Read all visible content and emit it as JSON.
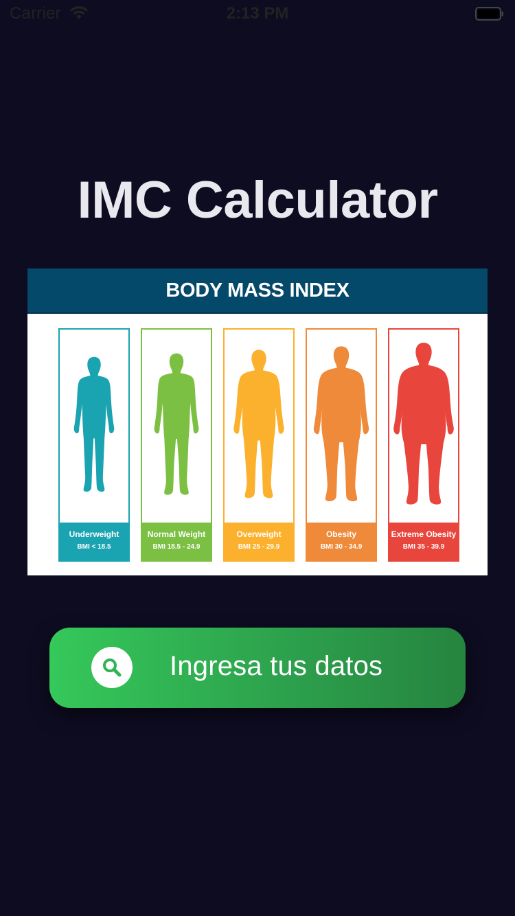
{
  "status_bar": {
    "carrier": "Carrier",
    "time": "2:13 PM"
  },
  "title": "IMC Calculator",
  "bmi_chart": {
    "header": "BODY MASS INDEX",
    "categories": [
      {
        "name": "Underweight",
        "range": "BMI < 18.5",
        "color": "#1aa3b0"
      },
      {
        "name": "Normal Weight",
        "range": "BMI 18.5 - 24.9",
        "color": "#7bc043"
      },
      {
        "name": "Overweight",
        "range": "BMI 25 - 29.9",
        "color": "#fbb12d"
      },
      {
        "name": "Obesity",
        "range": "BMI 30 - 34.9",
        "color": "#ee8a3a"
      },
      {
        "name": "Extreme Obesity",
        "range": "BMI 35 - 39.9",
        "color": "#e8453c"
      }
    ]
  },
  "cta": {
    "label": "Ingresa tus datos",
    "icon": "search-icon",
    "color_start": "#35c85a",
    "color_end": "#26843f"
  },
  "colors": {
    "background": "#0e0c21",
    "title": "#e9e8ee",
    "chart_header": "#05496a"
  }
}
